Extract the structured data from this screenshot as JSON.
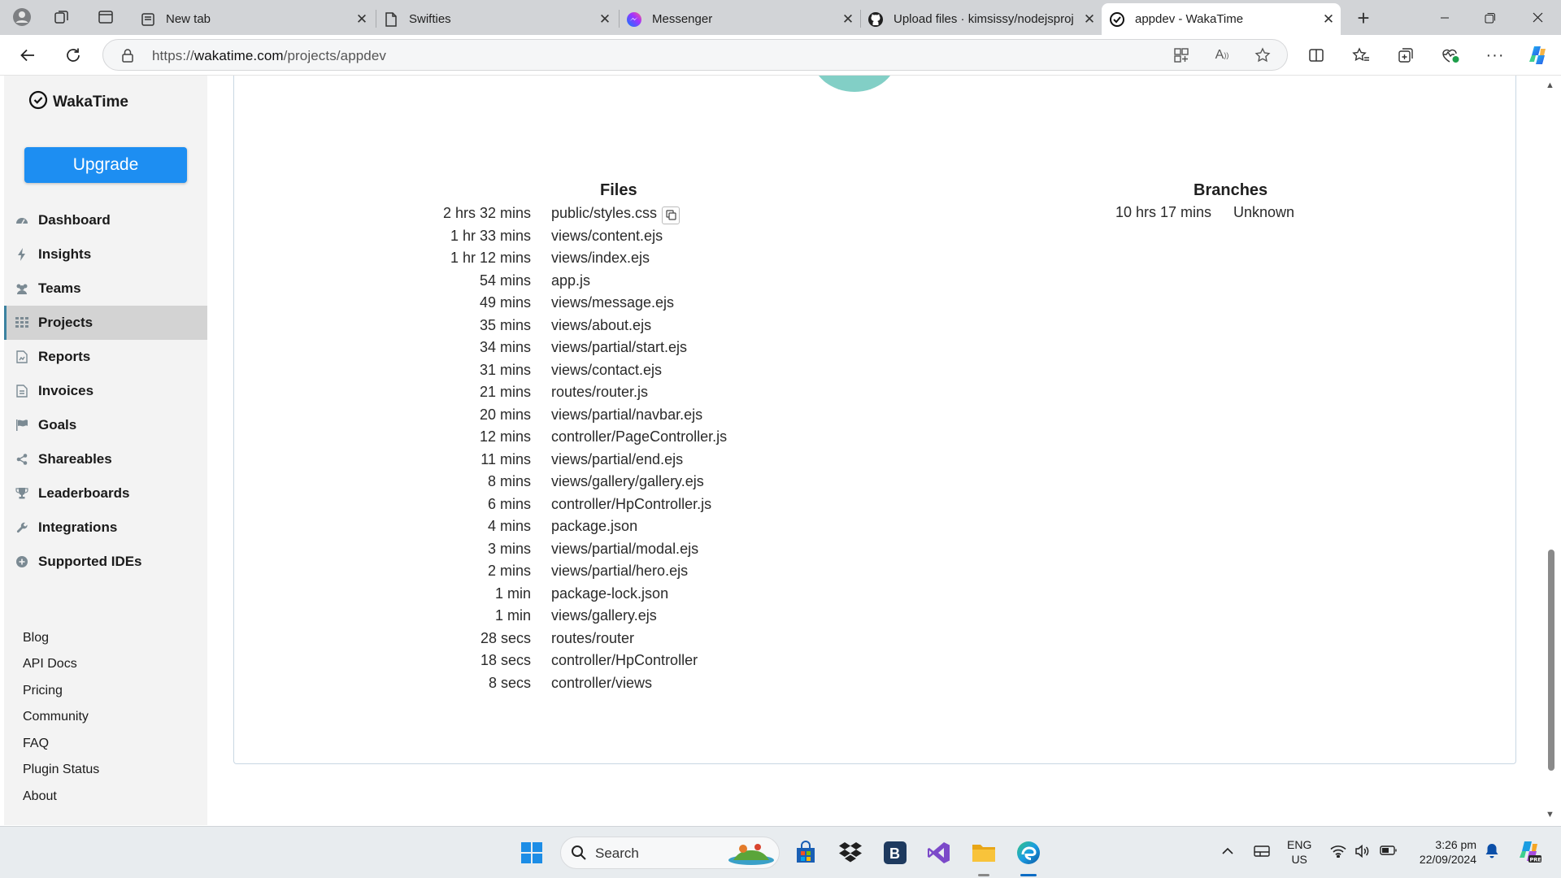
{
  "browser": {
    "tabs": [
      {
        "title": "New tab",
        "icon": "new-tab-page-icon",
        "active": false
      },
      {
        "title": "Swifties",
        "icon": "document-icon",
        "active": false
      },
      {
        "title": "Messenger",
        "icon": "messenger-icon",
        "active": false
      },
      {
        "title": "Upload files · kimsissy/nodejsproj",
        "icon": "github-icon",
        "active": false
      },
      {
        "title": "appdev - WakaTime",
        "icon": "wakatime-icon",
        "active": true
      }
    ],
    "address": {
      "scheme": "https://",
      "host": "wakatime.com",
      "path": "/projects/appdev"
    }
  },
  "sidebar": {
    "brand": "WakaTime",
    "upgrade_label": "Upgrade",
    "nav": [
      {
        "label": "Dashboard",
        "icon": "dashboard-icon",
        "active": false
      },
      {
        "label": "Insights",
        "icon": "bolt-icon",
        "active": false
      },
      {
        "label": "Teams",
        "icon": "users-icon",
        "active": false
      },
      {
        "label": "Projects",
        "icon": "grid-icon",
        "active": true
      },
      {
        "label": "Reports",
        "icon": "report-icon",
        "active": false
      },
      {
        "label": "Invoices",
        "icon": "invoice-icon",
        "active": false
      },
      {
        "label": "Goals",
        "icon": "flag-icon",
        "active": false
      },
      {
        "label": "Shareables",
        "icon": "share-icon",
        "active": false
      },
      {
        "label": "Leaderboards",
        "icon": "trophy-icon",
        "active": false
      },
      {
        "label": "Integrations",
        "icon": "wrench-icon",
        "active": false
      },
      {
        "label": "Supported IDEs",
        "icon": "plus-circle-icon",
        "active": false
      }
    ],
    "footer_links": [
      "Blog",
      "API Docs",
      "Pricing",
      "Community",
      "FAQ",
      "Plugin Status",
      "About"
    ]
  },
  "main": {
    "files": {
      "title": "Files",
      "rows": [
        {
          "duration": "2 hrs 32 mins",
          "file": "public/styles.css"
        },
        {
          "duration": "1 hr 33 mins",
          "file": "views/content.ejs"
        },
        {
          "duration": "1 hr 12 mins",
          "file": "views/index.ejs"
        },
        {
          "duration": "54 mins",
          "file": "app.js"
        },
        {
          "duration": "49 mins",
          "file": "views/message.ejs"
        },
        {
          "duration": "35 mins",
          "file": "views/about.ejs"
        },
        {
          "duration": "34 mins",
          "file": "views/partial/start.ejs"
        },
        {
          "duration": "31 mins",
          "file": "views/contact.ejs"
        },
        {
          "duration": "21 mins",
          "file": "routes/router.js"
        },
        {
          "duration": "20 mins",
          "file": "views/partial/navbar.ejs"
        },
        {
          "duration": "12 mins",
          "file": "controller/PageController.js"
        },
        {
          "duration": "11 mins",
          "file": "views/partial/end.ejs"
        },
        {
          "duration": "8 mins",
          "file": "views/gallery/gallery.ejs"
        },
        {
          "duration": "6 mins",
          "file": "controller/HpController.js"
        },
        {
          "duration": "4 mins",
          "file": "package.json"
        },
        {
          "duration": "3 mins",
          "file": "views/partial/modal.ejs"
        },
        {
          "duration": "2 mins",
          "file": "views/partial/hero.ejs"
        },
        {
          "duration": "1 min",
          "file": "package-lock.json"
        },
        {
          "duration": "1 min",
          "file": "views/gallery.ejs"
        },
        {
          "duration": "28 secs",
          "file": "routes/router"
        },
        {
          "duration": "18 secs",
          "file": "controller/HpController"
        },
        {
          "duration": "8 secs",
          "file": "controller/views"
        }
      ]
    },
    "branches": {
      "title": "Branches",
      "rows": [
        {
          "duration": "10 hrs 17 mins",
          "branch": "Unknown"
        }
      ]
    }
  },
  "taskbar": {
    "search_label": "Search",
    "lang_line1": "ENG",
    "lang_line2": "US",
    "time": "3:26 pm",
    "date": "22/09/2024"
  },
  "colors": {
    "upgrade": "#1d8ef2",
    "active_nav_bg": "#d3d3d3",
    "pie_segment": "#82cfc6"
  }
}
